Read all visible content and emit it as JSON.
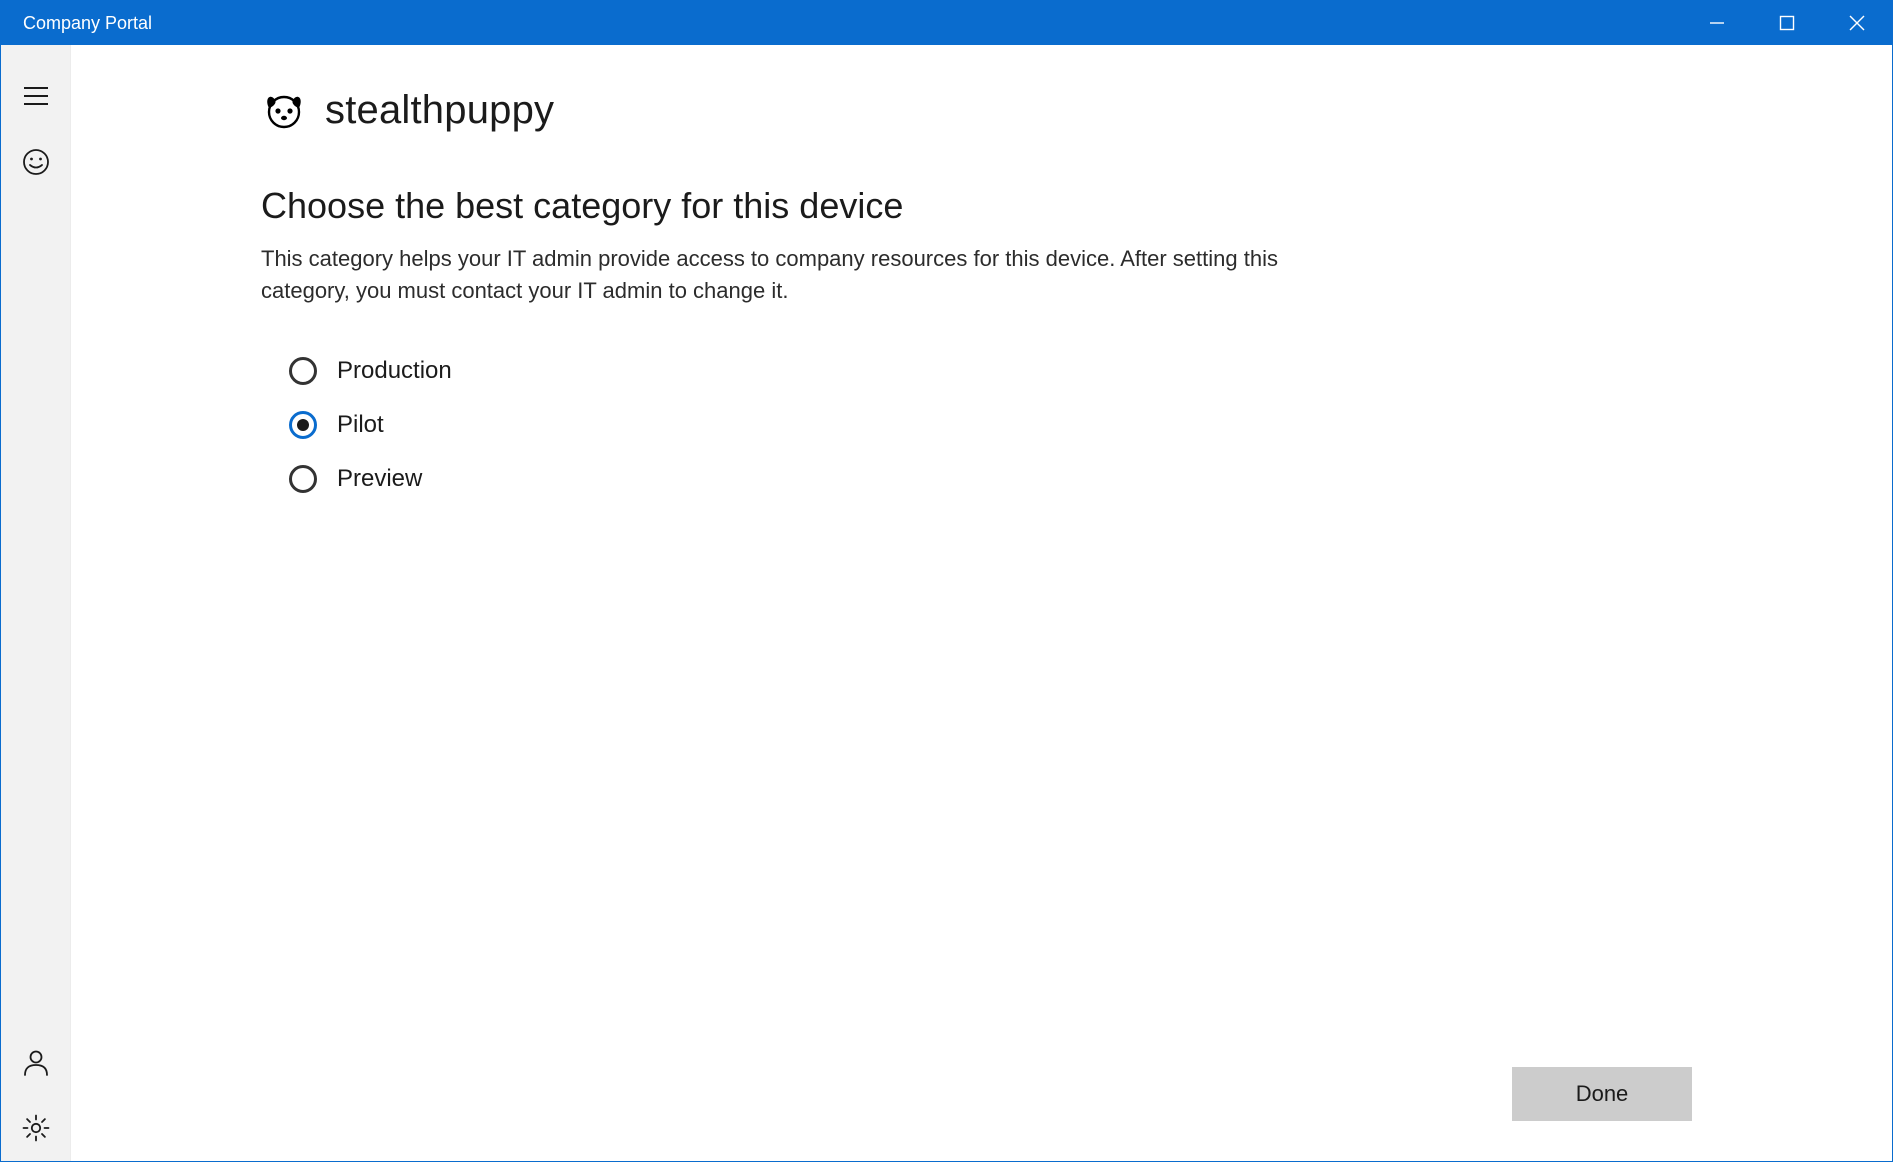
{
  "titlebar": {
    "title": "Company Portal"
  },
  "org": {
    "name": "stealthpuppy"
  },
  "page": {
    "heading": "Choose the best category for this device",
    "subheading": "This category helps your IT admin provide access to company resources for this device. After setting this category, you must contact your IT admin to change it."
  },
  "options": {
    "items": [
      {
        "label": "Production",
        "selected": false
      },
      {
        "label": "Pilot",
        "selected": true
      },
      {
        "label": "Preview",
        "selected": false
      }
    ]
  },
  "footer": {
    "done": "Done"
  },
  "colors": {
    "accent": "#0a6cce",
    "rail_bg": "#f2f2f2",
    "button_bg": "#cccccc",
    "text": "#1b1b1b"
  },
  "icons": {
    "hamburger": "hamburger-icon",
    "feedback": "smile-icon",
    "user": "user-icon",
    "settings": "gear-icon",
    "minimize": "minimize-icon",
    "maximize": "maximize-icon",
    "close": "close-icon",
    "logo": "puppy-logo-icon"
  }
}
